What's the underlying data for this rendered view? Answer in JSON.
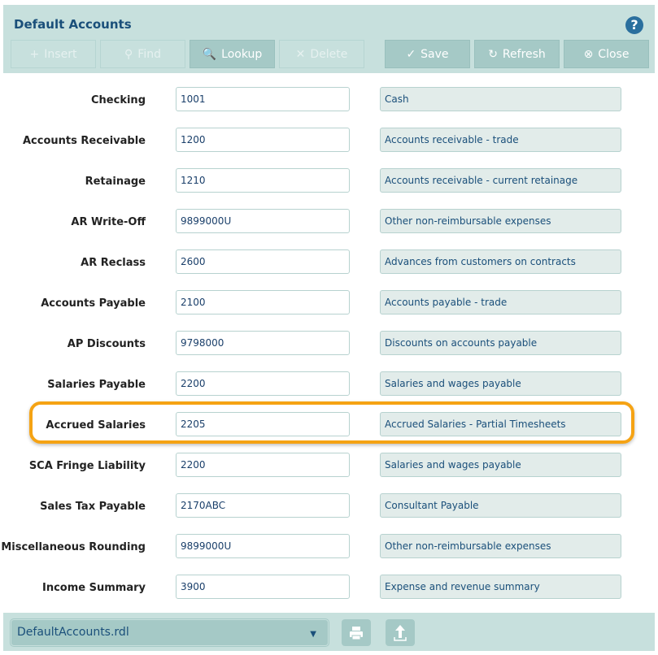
{
  "header": {
    "title": "Default Accounts",
    "help": "?"
  },
  "toolbar": [
    {
      "label": "Insert",
      "icon": "+",
      "enabled": false
    },
    {
      "label": "Find",
      "icon": "⚲",
      "enabled": false
    },
    {
      "label": "Lookup",
      "icon": "🔍",
      "enabled": true
    },
    {
      "label": "Delete",
      "icon": "✕",
      "enabled": false
    },
    {
      "label": "Save",
      "icon": "✓",
      "enabled": true
    },
    {
      "label": "Refresh",
      "icon": "↻",
      "enabled": true
    },
    {
      "label": "Close",
      "icon": "⊗",
      "enabled": true
    }
  ],
  "rows": [
    {
      "label": "Checking",
      "account": "1001",
      "description": "Cash"
    },
    {
      "label": "Accounts Receivable",
      "account": "1200",
      "description": "Accounts receivable - trade"
    },
    {
      "label": "Retainage",
      "account": "1210",
      "description": "Accounts receivable - current retainage"
    },
    {
      "label": "AR Write-Off",
      "account": "9899000U",
      "description": "Other non-reimbursable expenses"
    },
    {
      "label": "AR Reclass",
      "account": "2600",
      "description": "Advances from customers on contracts"
    },
    {
      "label": "Accounts Payable",
      "account": "2100",
      "description": "Accounts payable - trade"
    },
    {
      "label": "AP Discounts",
      "account": "9798000",
      "description": "Discounts on accounts payable"
    },
    {
      "label": "Salaries Payable",
      "account": "2200",
      "description": "Salaries and wages payable"
    },
    {
      "label": "Accrued Salaries",
      "account": "2205",
      "description": "Accrued Salaries - Partial Timesheets"
    },
    {
      "label": "SCA Fringe Liability",
      "account": "2200",
      "description": "Salaries and wages payable"
    },
    {
      "label": "Sales Tax Payable",
      "account": "2170ABC",
      "description": "Consultant Payable"
    },
    {
      "label": "Miscellaneous Rounding",
      "account": "9899000U",
      "description": "Other non-reimbursable expenses"
    },
    {
      "label": "Income Summary",
      "account": "3900",
      "description": "Expense and revenue summary"
    }
  ],
  "highlight": {
    "row": "Accrued Salaries",
    "color": "#f5a314"
  },
  "footer": {
    "report": "DefaultAccounts.rdl",
    "print_icon": "printer-icon",
    "upload_icon": "upload-icon"
  }
}
